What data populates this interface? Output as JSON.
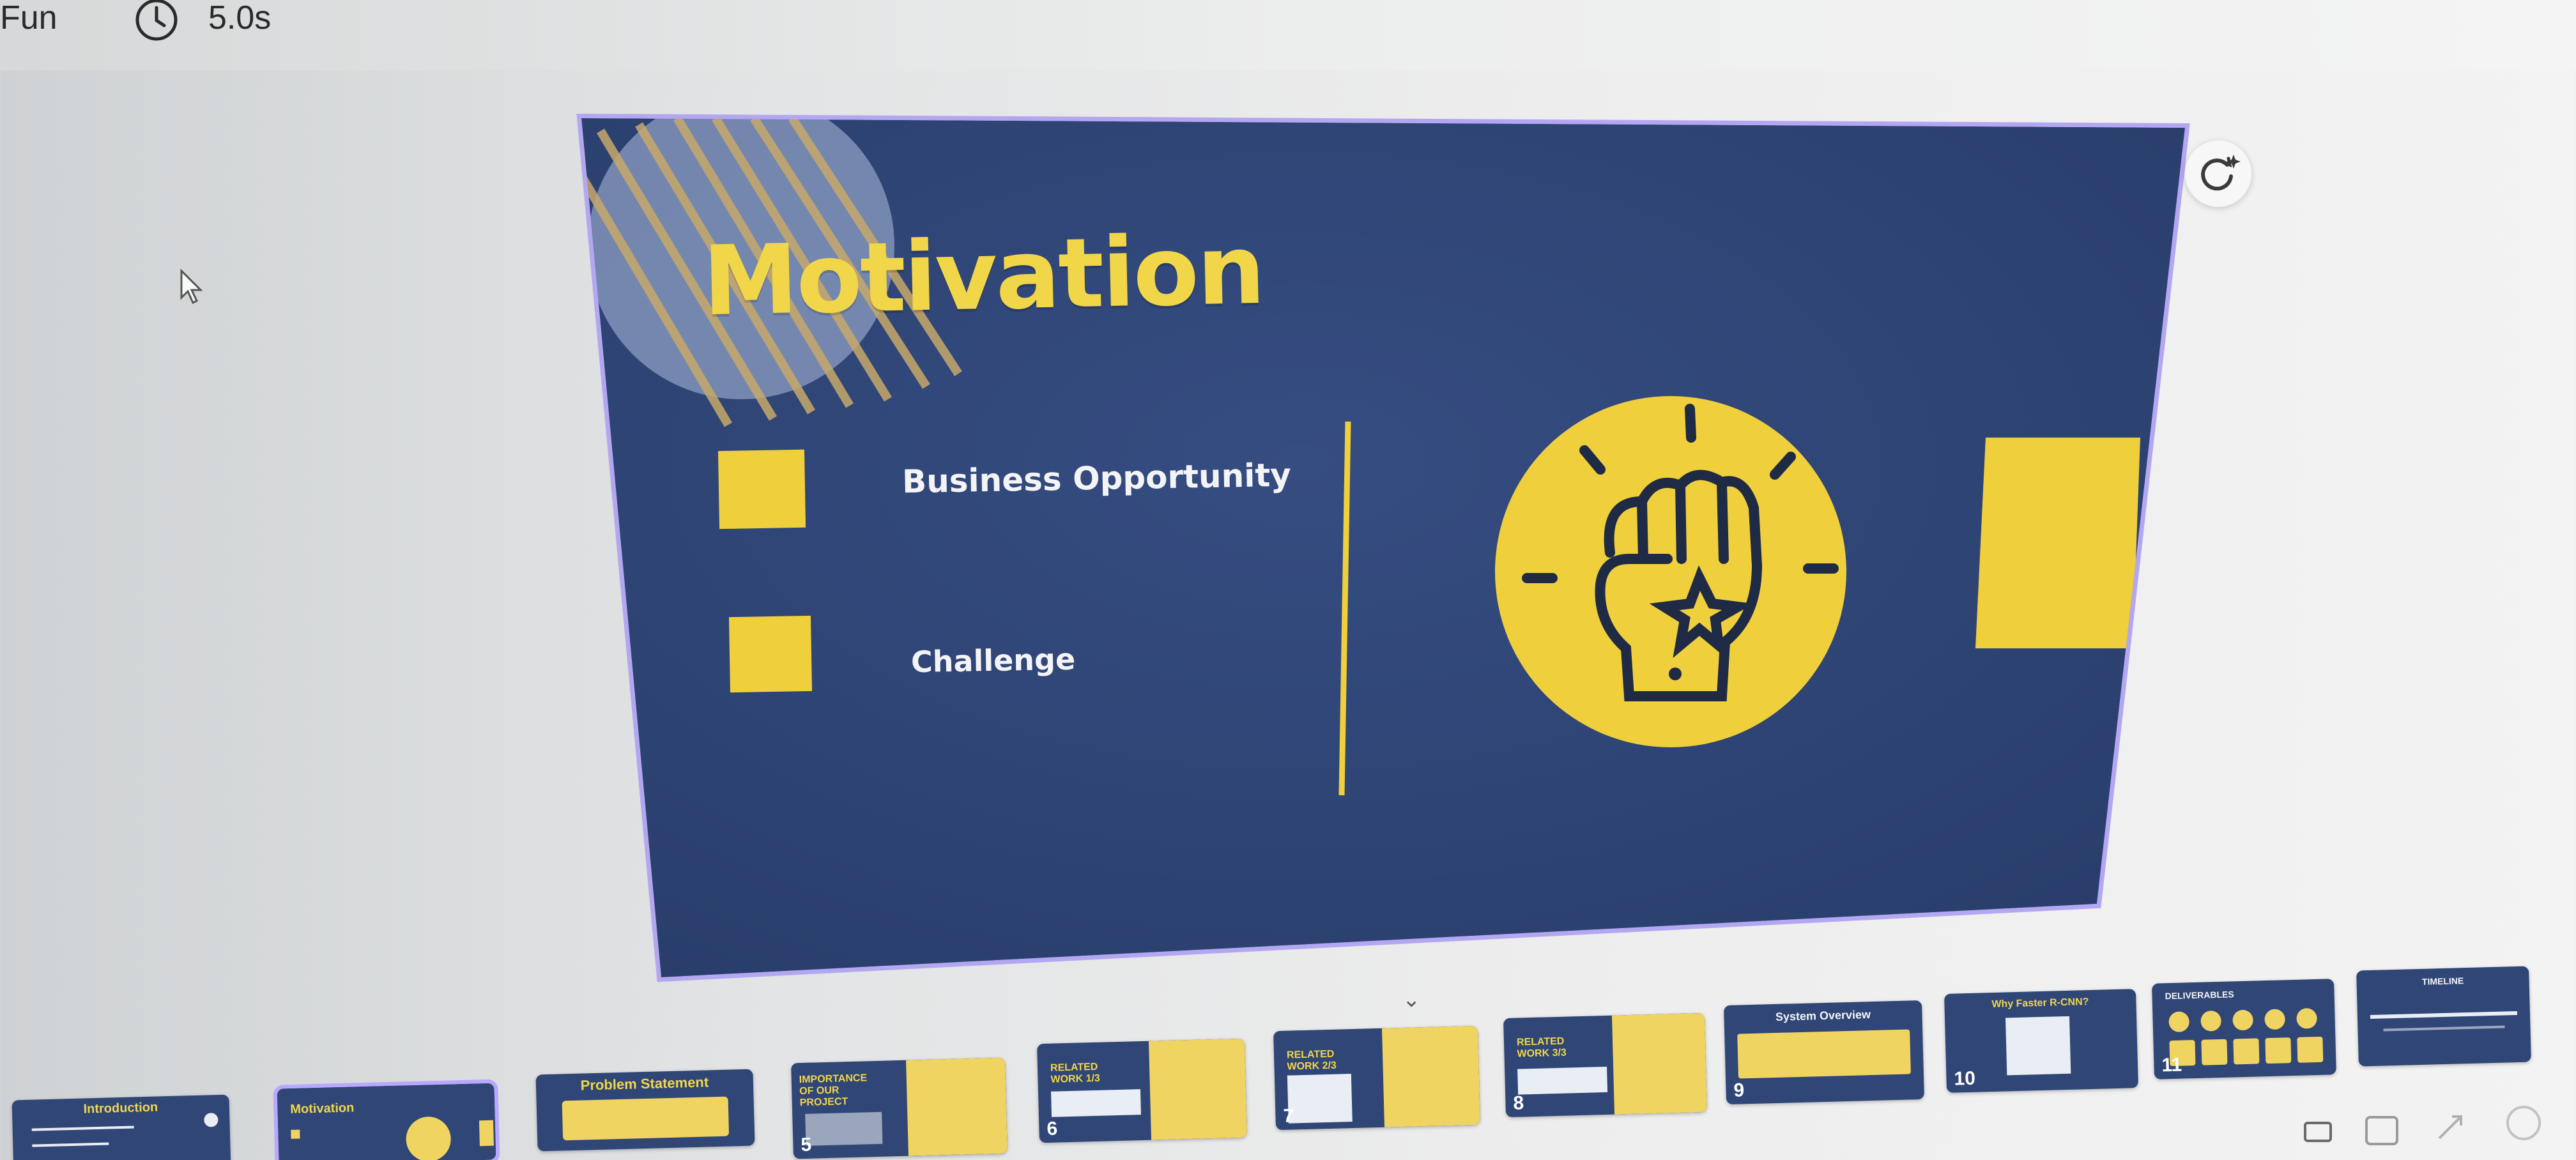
{
  "toolbar": {
    "animation_label": "Fun",
    "clock_icon": "clock-icon",
    "duration": "5.0s"
  },
  "slide": {
    "title": "Motivation",
    "bullets": [
      {
        "label": "Business Opportunity"
      },
      {
        "label": "Challenge"
      }
    ],
    "icon": "raised-fist-icon",
    "colors": {
      "background": "#2f4676",
      "accent": "#f2d64a",
      "text": "#f4f4f6"
    }
  },
  "canvas_actions": {
    "ai_refresh_icon": "refresh-sparkle-icon",
    "collapse_icon": "chevron-down-icon",
    "collapse_glyph": "⌄"
  },
  "filmstrip": {
    "thumbnails": [
      {
        "number": "",
        "title": "Introduction"
      },
      {
        "number": "",
        "title": "Motivation",
        "selected": true
      },
      {
        "number": "",
        "title": "Problem Statement"
      },
      {
        "number": "5",
        "title": "IMPORTANCE OF OUR PROJECT"
      },
      {
        "number": "6",
        "title": "RELATED WORK 1/3"
      },
      {
        "number": "7",
        "title": "RELATED WORK 2/3"
      },
      {
        "number": "8",
        "title": "RELATED WORK 3/3"
      },
      {
        "number": "9",
        "title": "System Overview"
      },
      {
        "number": "10",
        "title": "Why Faster R-CNN?"
      },
      {
        "number": "11",
        "title": "DELIVERABLES"
      },
      {
        "number": "",
        "title": "TIMELINE"
      }
    ]
  },
  "bottom_icons": [
    "page-grid-icon",
    "fullscreen-icon",
    "expand-icon",
    "help-icon"
  ]
}
